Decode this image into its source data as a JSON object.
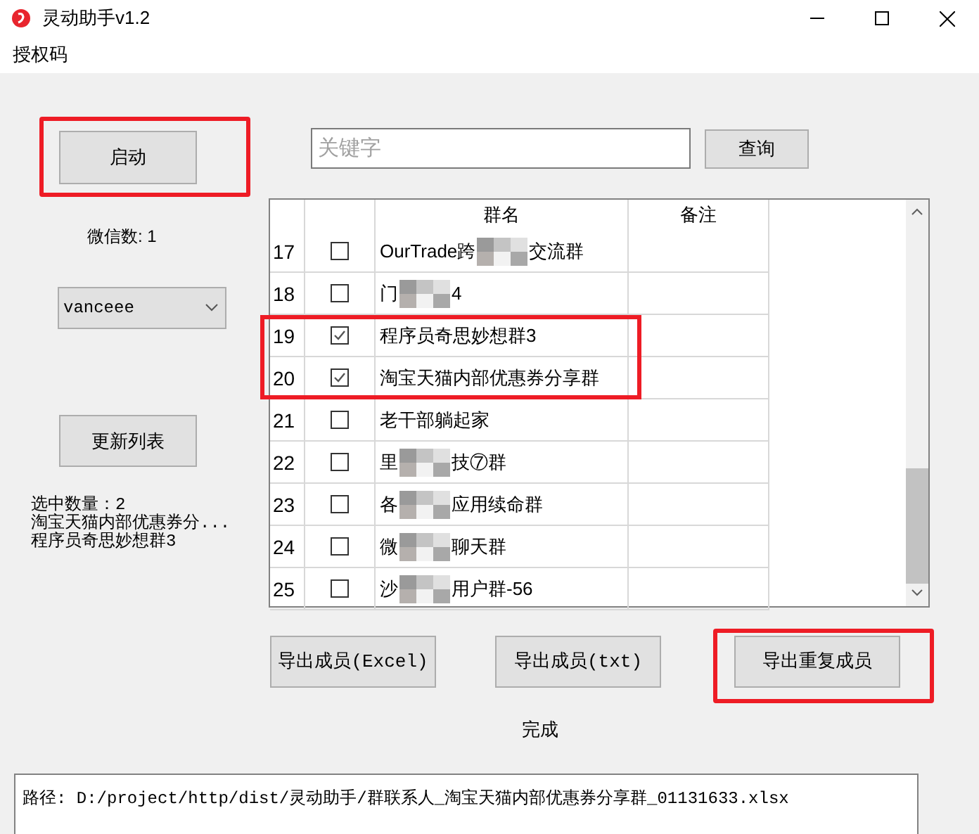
{
  "window": {
    "title": "灵动助手v1.2"
  },
  "menu": [
    "授权码"
  ],
  "start_button": {
    "label": "启动",
    "highlighted": true
  },
  "wechat_count": "微信数: 1",
  "account_select": {
    "value": "vanceee"
  },
  "refresh_button": {
    "label": "更新列表",
    "highlighted": false
  },
  "selection_info": [
    "选中数量：2",
    "淘宝天猫内部优惠券分...",
    "程序员奇思妙想群3"
  ],
  "search": {
    "placeholder": "关键字",
    "button": "查询"
  },
  "table": {
    "columns": [
      "群名",
      "备注"
    ],
    "rows": [
      {
        "index": "17",
        "checked": false,
        "highlighted": false,
        "name_parts": [
          "OurTrade跨",
          "交流群"
        ]
      },
      {
        "index": "18",
        "checked": false,
        "highlighted": false,
        "name_parts": [
          "门",
          "4"
        ]
      },
      {
        "index": "19",
        "checked": true,
        "highlighted": true,
        "name_parts": [
          "程序员奇思妙想群3"
        ]
      },
      {
        "index": "20",
        "checked": true,
        "highlighted": true,
        "name_parts": [
          "淘宝天猫内部优惠券分享群"
        ]
      },
      {
        "index": "21",
        "checked": false,
        "highlighted": false,
        "name_parts": [
          "老干部躺起家"
        ]
      },
      {
        "index": "22",
        "checked": false,
        "highlighted": false,
        "name_parts": [
          "里",
          "技⑦群"
        ]
      },
      {
        "index": "23",
        "checked": false,
        "highlighted": false,
        "name_parts": [
          "各",
          "应用续命群"
        ]
      },
      {
        "index": "24",
        "checked": false,
        "highlighted": false,
        "name_parts": [
          "微",
          "聊天群"
        ]
      },
      {
        "index": "25",
        "checked": false,
        "highlighted": false,
        "name_parts": [
          "沙",
          "用户群-56"
        ]
      }
    ]
  },
  "export_buttons": [
    {
      "label": "导出成员(Excel)",
      "highlighted": false
    },
    {
      "label": "导出成员(txt)",
      "highlighted": false
    },
    {
      "label": "导出重复成员",
      "highlighted": true
    }
  ],
  "status": "完成",
  "path_output": "路径: D:/project/http/dist/灵动助手/群联系人_淘宝天猫内部优惠券分享群_01131633.xlsx"
}
